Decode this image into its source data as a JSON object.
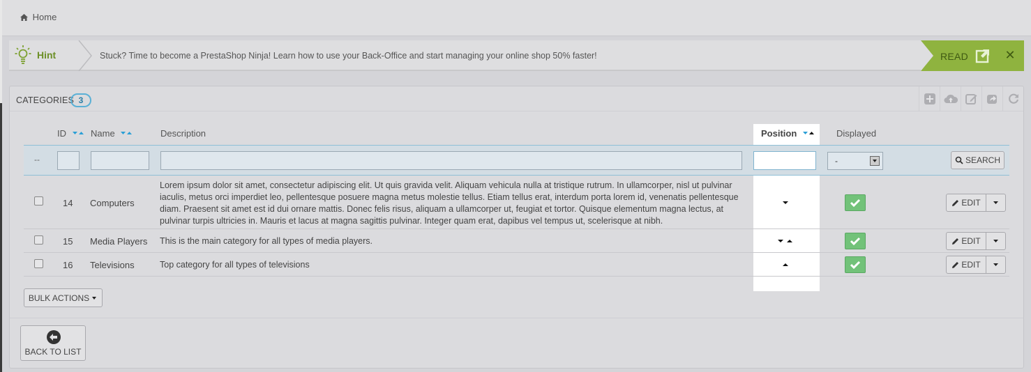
{
  "breadcrumb": {
    "home_label": "Home"
  },
  "hint": {
    "title": "Hint",
    "text": "Stuck? Time to become a PrestaShop Ninja! Learn how to use your Back-Office and start managing your online shop 50% faster!",
    "read_label": "READ",
    "close_glyph": "✕"
  },
  "panel": {
    "title": "CATEGORIES",
    "count": "3",
    "toolbar_icons": [
      "add-icon",
      "cloud-upload-icon",
      "edit-sql-icon",
      "export-icon",
      "refresh-icon"
    ]
  },
  "table": {
    "headers": {
      "id": "ID",
      "name": "Name",
      "description": "Description",
      "position": "Position",
      "displayed": "Displayed"
    },
    "filter": {
      "dash": "--",
      "displayed_select": "-",
      "search_label": "SEARCH"
    },
    "rows": [
      {
        "id": "14",
        "name": "Computers",
        "description": "Lorem ipsum dolor sit amet, consectetur adipiscing elit. Ut quis gravida velit. Aliquam vehicula nulla at tristique rutrum. In ullamcorper, nisl ut pulvinar iaculis, metus orci imperdiet leo, pellentesque posuere magna metus molestie tellus. Etiam tellus erat, interdum porta lorem id, venenatis pellentesque diam. Praesent sit amet est id dui ornare mattis. Donec felis risus, aliquam a ullamcorper ut, feugiat et tortor. Quisque elementum magna lectus, at pulvinar turpis ultricies in. Mauris et lacus at magna sagittis pulvinar. Integer quam erat, dapibus vel tempus ut, scelerisque at nibh.",
        "edit_label": "EDIT",
        "displayed": true
      },
      {
        "id": "15",
        "name": "Media Players",
        "description": "This is the main category for all types of media players.",
        "edit_label": "EDIT",
        "displayed": true
      },
      {
        "id": "16",
        "name": "Televisions",
        "description": "Top category for all types of televisions",
        "edit_label": "EDIT",
        "displayed": true
      }
    ]
  },
  "bulk_actions_label": "BULK ACTIONS",
  "back_to_list_label": "BACK TO LIST",
  "colors": {
    "accent_green": "#8fb33f",
    "accent_blue": "#2a9fd6",
    "check_green": "#72c279"
  }
}
